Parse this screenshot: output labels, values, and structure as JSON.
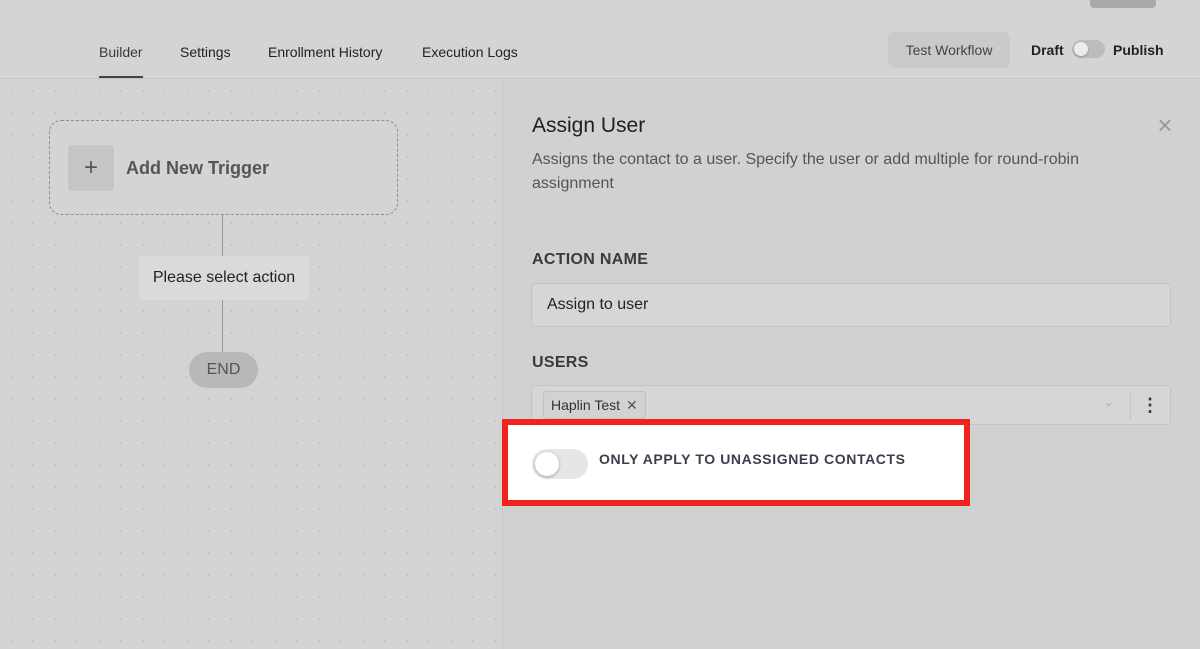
{
  "header": {
    "tabs": [
      {
        "label": "Builder",
        "active": true
      },
      {
        "label": "Settings",
        "active": false
      },
      {
        "label": "Enrollment History",
        "active": false
      },
      {
        "label": "Execution Logs",
        "active": false
      }
    ],
    "test_button": "Test Workflow",
    "draft_label": "Draft",
    "publish_label": "Publish",
    "publish_toggle_on": false
  },
  "canvas": {
    "trigger_label": "Add New Trigger",
    "trigger_icon": "plus-icon",
    "action_placeholder": "Please select action",
    "end_label": "END"
  },
  "panel": {
    "title": "Assign User",
    "description": "Assigns the contact to a user. Specify the user or add multiple for round-robin assignment",
    "close_icon": "close-icon",
    "action_name_label": "ACTION NAME",
    "action_name_value": "Assign to user",
    "users_label": "USERS",
    "selected_users": [
      "Haplin Test"
    ],
    "toggle_label": "ONLY APPLY TO UNASSIGNED CONTACTS",
    "toggle_on": false
  },
  "colors": {
    "highlight_border": "#f2221c",
    "background": "#d2d2d2"
  }
}
